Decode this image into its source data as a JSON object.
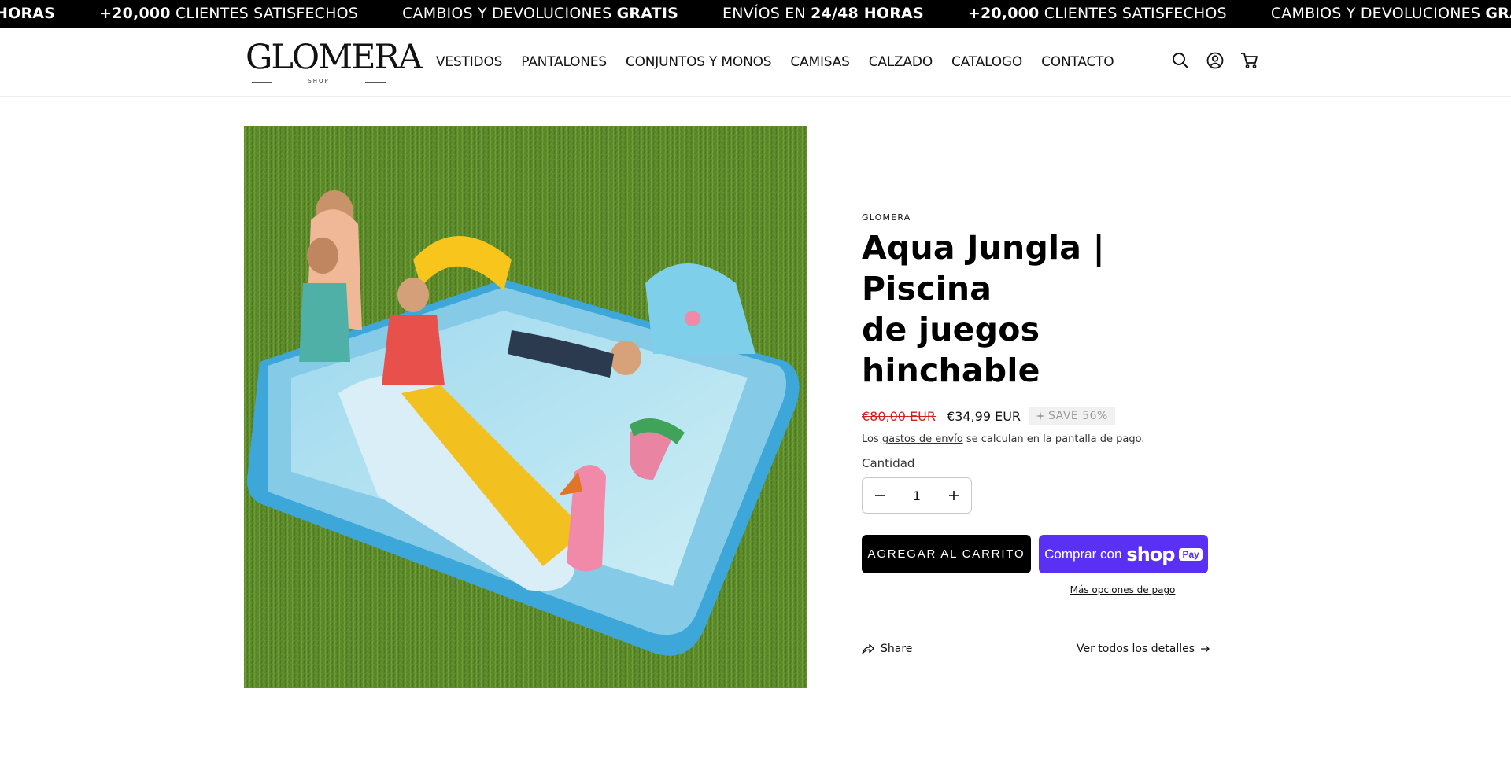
{
  "announcement": {
    "items": [
      {
        "prefix": "",
        "bold": "HORAS",
        "suffix": ""
      },
      {
        "prefix": "",
        "bold": "+20,000",
        "suffix": " CLIENTES SATISFECHOS"
      },
      {
        "prefix": "CAMBIOS Y DEVOLUCIONES ",
        "bold": "GRATIS",
        "suffix": ""
      },
      {
        "prefix": "ENVÍOS EN ",
        "bold": "24/48 HORAS",
        "suffix": ""
      },
      {
        "prefix": "",
        "bold": "+20,000",
        "suffix": " CLIENTES SATISFECHOS"
      },
      {
        "prefix": "CAMBIOS Y DEVOLUCIONES ",
        "bold": "GRATIS",
        "suffix": ""
      }
    ]
  },
  "header": {
    "logo_text": "GLOMERA",
    "logo_sub": "SHOP",
    "nav": [
      "VESTIDOS",
      "PANTALONES",
      "CONJUNTOS Y MONOS",
      "CAMISAS",
      "CALZADO",
      "CATALOGO",
      "CONTACTO"
    ],
    "icons": [
      "search-icon",
      "account-icon",
      "cart-icon"
    ]
  },
  "product": {
    "vendor": "GLOMERA",
    "title_line1": "Aqua Jungla | Piscina",
    "title_line2": "de juegos hinchable",
    "price_compare": "€80,00 EUR",
    "price_sale": "€34,99 EUR",
    "save_badge": "SAVE 56%",
    "shipping_pre": "Los ",
    "shipping_link": "gastos de envío",
    "shipping_post": " se calculan en la pantalla de pago.",
    "quantity_label": "Cantidad",
    "quantity_value": "1",
    "add_to_cart": "AGREGAR AL CARRITO",
    "shop_pay_prefix": "Comprar con",
    "shop_pay_word": "shop",
    "shop_pay_pill": "Pay",
    "more_options": "Más opciones de pago",
    "share_label": "Share",
    "details_label": "Ver todos los detalles"
  },
  "colors": {
    "marquee_bg": "#000000",
    "sale_red": "#d12020",
    "shop_pay": "#5a31f4"
  }
}
